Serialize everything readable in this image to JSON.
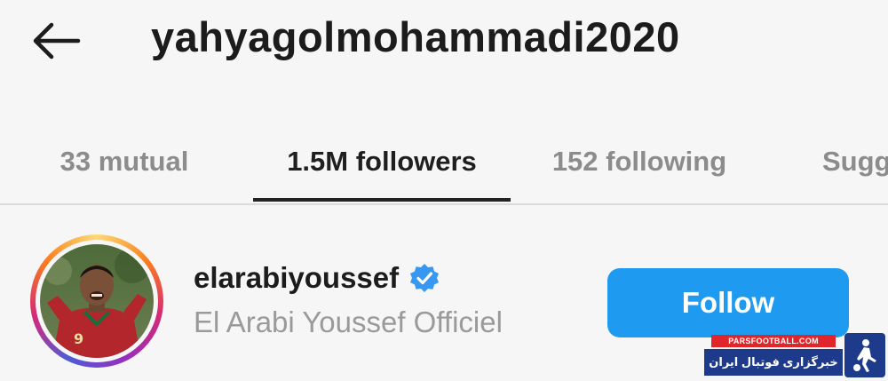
{
  "header": {
    "title": "yahyagolmohammadi2020",
    "back_icon": "arrow-left-icon"
  },
  "tabs": [
    {
      "label": "33 mutual",
      "active": false
    },
    {
      "label": "1.5M followers",
      "active": true
    },
    {
      "label": "152 following",
      "active": false
    },
    {
      "label": "Sugg",
      "active": false
    }
  ],
  "follower": {
    "username": "elarabiyoussef",
    "full_name": "El Arabi Youssef Officiel",
    "verified": true,
    "verified_icon": "verified-badge-icon",
    "follow_label": "Follow"
  },
  "watermark": {
    "site": "PARSFOOTBALL.COM",
    "tagline": "خبرگزاری فوتبال ایران"
  },
  "colors": {
    "accent": "#1e9bf0",
    "story_ring": [
      "#feda75",
      "#fa7e1e",
      "#d62976",
      "#962fbf",
      "#4f5bd5"
    ]
  }
}
